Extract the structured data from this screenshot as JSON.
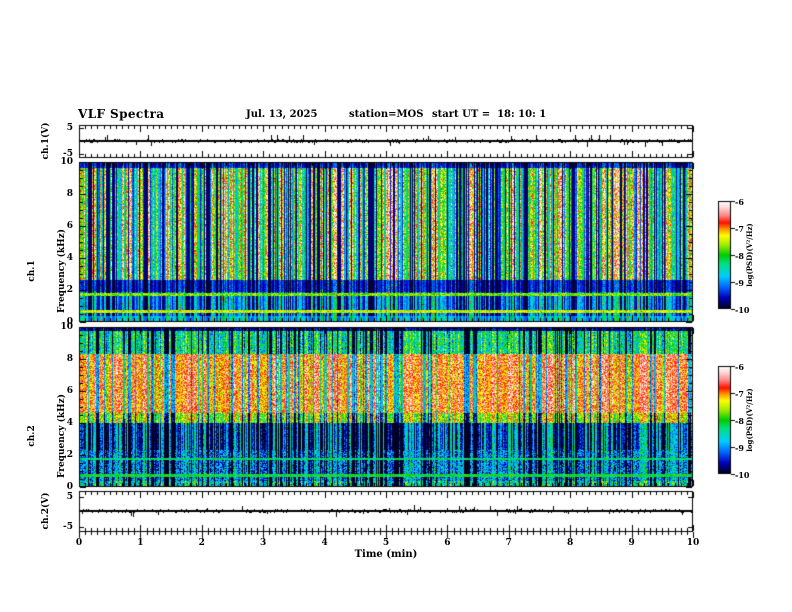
{
  "header": {
    "title": "VLF Spectra",
    "date": "Jul. 13, 2025",
    "station": "station=MOS",
    "start_ut": "start UT =  18: 10: 1"
  },
  "x_axis": {
    "label": "Time (min)",
    "range": [
      0,
      10
    ],
    "tick_labels": [
      "0",
      "1",
      "2",
      "3",
      "4",
      "5",
      "6",
      "7",
      "8",
      "9",
      "10"
    ],
    "minor_tick_step_min": 0.1
  },
  "colorbar": {
    "label": "log(PSD)(V²/Hz)",
    "tick_labels": [
      "-6",
      "-7",
      "-8",
      "-9",
      "-10"
    ],
    "range": [
      -10,
      -6
    ]
  },
  "colormap_stops": [
    [
      0,
      "#000022"
    ],
    [
      0.1,
      "#0000bb"
    ],
    [
      0.2,
      "#0066ff"
    ],
    [
      0.3,
      "#00ccff"
    ],
    [
      0.42,
      "#00e080"
    ],
    [
      0.5,
      "#00cc00"
    ],
    [
      0.6,
      "#aaee00"
    ],
    [
      0.68,
      "#ffff00"
    ],
    [
      0.74,
      "#ff9900"
    ],
    [
      0.8,
      "#ff1100"
    ],
    [
      0.87,
      "#ff8888"
    ],
    [
      0.95,
      "#ffdddd"
    ],
    [
      1,
      "#ffffff"
    ]
  ],
  "chart_data": [
    {
      "type": "line",
      "name": "ch1-waveform",
      "ylabel": "ch.1(V)",
      "ylim": [
        -5,
        5
      ],
      "ytick_labels": [
        "5",
        "-5"
      ],
      "baseline_value": 0,
      "description": "near-flat trace at 0 V across 0-10 min with sporadic small impulsive spikes"
    },
    {
      "type": "heatmap",
      "name": "ch1-spectrogram",
      "channel": "ch.1",
      "ylabel": "Frequency (kHz)",
      "ylim": [
        0,
        10
      ],
      "ytick_labels": [
        "10",
        "8",
        "6",
        "4",
        "2",
        "0"
      ],
      "value_range": [
        -10,
        -6
      ],
      "background_value": -10,
      "bands": [
        {
          "f": [
            9.6,
            10.01
          ],
          "stripe": 0.25
        },
        {
          "f": [
            2.6,
            9.6
          ],
          "stripe": 1.0
        },
        {
          "f": [
            1.9,
            2.6
          ],
          "stripe": 0.25
        },
        {
          "f": [
            0.35,
            1.9
          ],
          "stripe": 0.5
        },
        {
          "f": [
            0,
            0.35
          ],
          "base": -9.3,
          "stripe": 0.35
        }
      ],
      "hlines": [
        {
          "f": 1.72,
          "value": -7.7
        },
        {
          "f": 0.68,
          "value": -7.5
        }
      ],
      "description": "dense vertical broadband impulses (green/cyan with red cores) on black background; quieter below 2.6 kHz; persistent narrowband horizontal lines near 1.7 kHz and 0.7 kHz"
    },
    {
      "type": "heatmap",
      "name": "ch2-spectrogram",
      "channel": "ch.2",
      "ylabel": "Frequency (kHz)",
      "ylim": [
        0,
        10
      ],
      "ytick_labels": [
        "10",
        "8",
        "6",
        "4",
        "2",
        "0"
      ],
      "value_range": [
        -10,
        -6
      ],
      "bands": [
        {
          "f": [
            9.75,
            10.01
          ],
          "base": -9.7,
          "stripe": 0.2,
          "noise": 0.4
        },
        {
          "f": [
            8.3,
            9.75
          ],
          "base": -8.4,
          "stripe": 0.5,
          "noise": 0.8
        },
        {
          "f": [
            4.6,
            8.3
          ],
          "base": -6.95,
          "stripe": 0.45,
          "noise": 0.55
        },
        {
          "f": [
            4.0,
            4.6
          ],
          "base": -7.7,
          "stripe": 0.6,
          "noise": 0.7
        },
        {
          "f": [
            2.3,
            4.0
          ],
          "base": -9.45,
          "stripe": 0.95,
          "noise": 0.5
        },
        {
          "f": [
            0.35,
            2.3
          ],
          "base": -9.1,
          "stripe": 0.5,
          "noise": 0.8
        },
        {
          "f": [
            0,
            0.35
          ],
          "base": -8.6,
          "stripe": 0.5,
          "noise": 0.9
        }
      ],
      "hlines": [
        {
          "f": 1.75,
          "value": -8.3
        },
        {
          "f": 0.72,
          "value": -8.1
        }
      ],
      "description": "continuous strong red/orange band ~4.6-8.3 kHz, green 8.3-9.7 kHz, dark band 2.3-4 kHz with impulse streaks, blue speckle below 2.3 kHz, narrow vertical dropout gaps throughout"
    },
    {
      "type": "line",
      "name": "ch2-waveform",
      "ylabel": "ch.2(V)",
      "ylim": [
        -5,
        5
      ],
      "ytick_labels": [
        "5",
        "-5"
      ],
      "baseline_value": 0,
      "description": "near-flat trace at 0 V across 0-10 min with sporadic small impulsive spikes"
    }
  ]
}
